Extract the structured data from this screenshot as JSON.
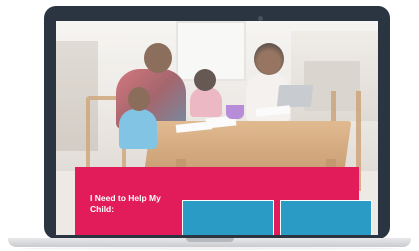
{
  "device": {
    "type": "laptop",
    "bezel_color": "#2b3541"
  },
  "hero": {
    "image": "family helping child with homework at kitchen table"
  },
  "cta": {
    "heading": "I Need to Help My Child:",
    "panel_color": "#e21c5b",
    "tile_color": "#2a9bc4"
  }
}
